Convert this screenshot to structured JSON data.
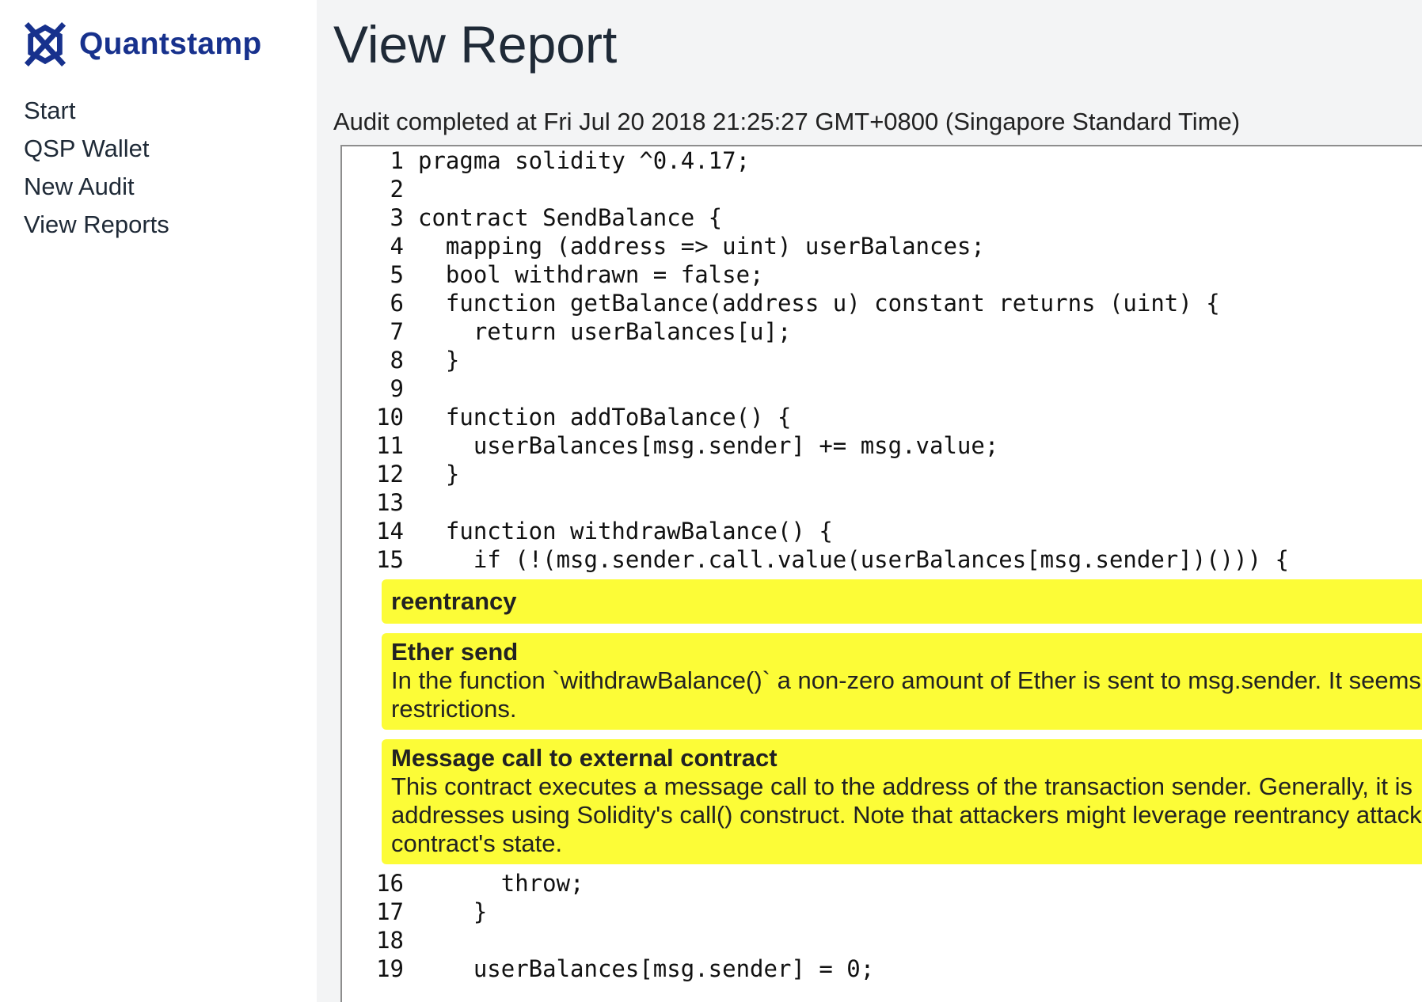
{
  "brand": {
    "name": "Quantstamp",
    "color": "#17318d"
  },
  "nav": [
    {
      "label": "Start"
    },
    {
      "label": "QSP Wallet"
    },
    {
      "label": "New Audit"
    },
    {
      "label": "View Reports"
    }
  ],
  "page": {
    "title": "View Report",
    "audit_status": "Audit completed at Fri Jul 20 2018 21:25:27 GMT+0800 (Singapore Standard Time)"
  },
  "code_before": [
    {
      "num": "1",
      "text": "pragma solidity ^0.4.17;"
    },
    {
      "num": "2",
      "text": ""
    },
    {
      "num": "3",
      "text": "contract SendBalance {"
    },
    {
      "num": "4",
      "text": "  mapping (address => uint) userBalances;"
    },
    {
      "num": "5",
      "text": "  bool withdrawn = false;"
    },
    {
      "num": "6",
      "text": "  function getBalance(address u) constant returns (uint) {"
    },
    {
      "num": "7",
      "text": "    return userBalances[u];"
    },
    {
      "num": "8",
      "text": "  }"
    },
    {
      "num": "9",
      "text": ""
    },
    {
      "num": "10",
      "text": "  function addToBalance() {"
    },
    {
      "num": "11",
      "text": "    userBalances[msg.sender] += msg.value;"
    },
    {
      "num": "12",
      "text": "  }"
    },
    {
      "num": "13",
      "text": ""
    },
    {
      "num": "14",
      "text": "  function withdrawBalance() {"
    },
    {
      "num": "15",
      "text": "    if (!(msg.sender.call.value(userBalances[msg.sender])())) {"
    }
  ],
  "issues": {
    "tag": "reentrancy",
    "ether_send": {
      "title": "Ether send",
      "desc_line1": "In the function `withdrawBalance()` a non-zero amount of Ether is sent to msg.sender. It seems",
      "desc_line2": "restrictions."
    },
    "external_call": {
      "title": "Message call to external contract",
      "desc_line1": "This contract executes a message call to the address of the transaction sender. Generally, it is",
      "desc_line2": "addresses using Solidity's call() construct. Note that attackers might leverage reentrancy attacks",
      "desc_line3": "contract's state."
    },
    "highlight_color": "#fcfc37"
  },
  "code_after": [
    {
      "num": "16",
      "text": "      throw;"
    },
    {
      "num": "17",
      "text": "    }"
    },
    {
      "num": "18",
      "text": ""
    },
    {
      "num": "19",
      "text": "    userBalances[msg.sender] = 0;"
    }
  ]
}
